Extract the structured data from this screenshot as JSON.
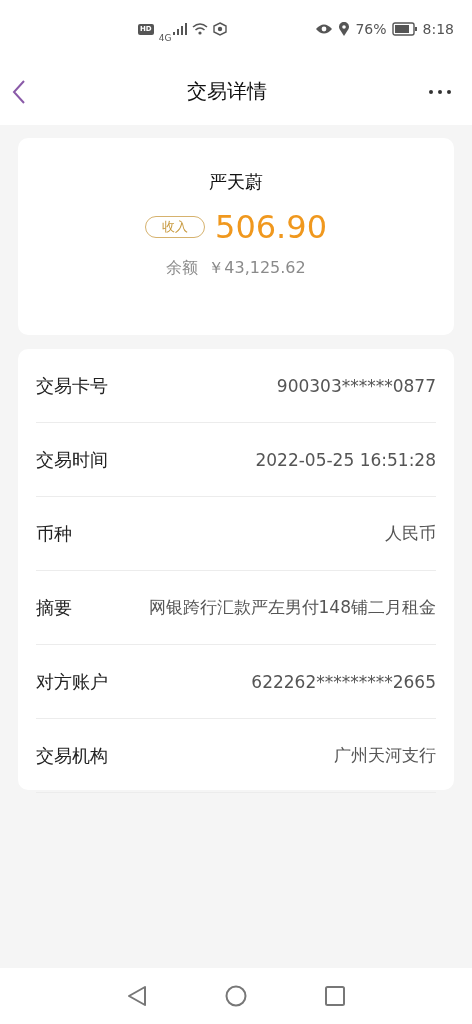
{
  "status_bar": {
    "hd": "HD",
    "network": "4G",
    "battery_percent": "76%",
    "time": "8:18"
  },
  "header": {
    "title": "交易详情"
  },
  "summary": {
    "name": "严天蔚",
    "direction": "收入",
    "amount": "506.90",
    "balance_label": "余额",
    "balance": "￥43,125.62"
  },
  "details": [
    {
      "label": "交易卡号",
      "value": "900303******0877"
    },
    {
      "label": "交易时间",
      "value": "2022-05-25 16:51:28"
    },
    {
      "label": "币种",
      "value": "人民币"
    },
    {
      "label": "摘要",
      "value": "网银跨行汇款严左男付148铺二月租金"
    },
    {
      "label": "对方账户",
      "value": "622262*********2665"
    },
    {
      "label": "交易机构",
      "value": "广州天河支行"
    }
  ]
}
